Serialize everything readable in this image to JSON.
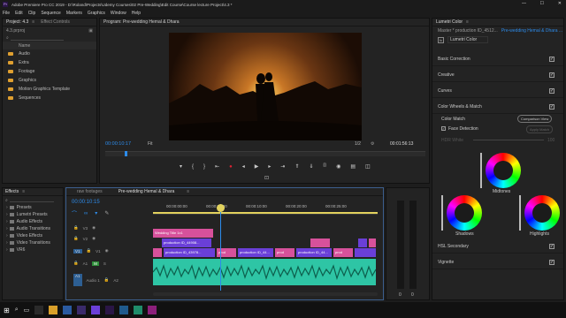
{
  "window": {
    "title": "Adobe Premiere Pro CC 2019 - D:\\Roland\\Projects\\Udemy Courses\\02 Pre-Wedding\\Edit Course\\Course lecture Project\\4.3 *",
    "minimize": "—",
    "maximize": "☐",
    "close": "✕"
  },
  "menu": [
    "File",
    "Edit",
    "Clip",
    "Sequence",
    "Markers",
    "Graphics",
    "Window",
    "Help"
  ],
  "project": {
    "tabs": [
      "Project: 4.3",
      "Effect Controls"
    ],
    "file": "4.3.prproj",
    "name_header": "Name",
    "items": [
      "Audio",
      "Extra",
      "Footage",
      "Graphics",
      "Motion Graphics Template",
      "Sequences"
    ]
  },
  "program": {
    "title": "Program: Pre-wedding Hemal & Dhara",
    "timecode": "00:00:10:17",
    "fit": "Fit",
    "resolution": "1/2",
    "duration": "00:01:56:13"
  },
  "effects": {
    "tab": "Effects",
    "items": [
      "Presets",
      "Lumetri Presets",
      "Audio Effects",
      "Audio Transitions",
      "Video Effects",
      "Video Transitions",
      "VR6"
    ]
  },
  "timeline": {
    "tabs": [
      "raw footages",
      "Pre-wedding Hemal & Dhara"
    ],
    "timecode": "00:00:10:15",
    "ruler": [
      "00:00:00:00",
      "00:00:05:00",
      "00:00:10:00",
      "00:00:20:00",
      "00:00:25:00"
    ],
    "tracks": [
      "V3",
      "V2",
      "V1",
      "A1",
      "A2"
    ],
    "clips": {
      "title": "Wedding Title 1x1",
      "c1": "production ID_44908...",
      "c2": "production ID_43978...",
      "p1": "prod",
      "p2": "production ID_44...",
      "p3": "prod",
      "p4": "production ID_44...",
      "p5": "prod"
    },
    "audio_label": "Audio 1",
    "meter_low": "0",
    "meter_high": "0"
  },
  "lumetri": {
    "title": "Lumetri Color",
    "master": "Master * production ID_4512...",
    "sequence": "Pre-wedding Hemal & Dhara ...",
    "fx": "Lumetri Color",
    "sections": [
      "Basic Correction",
      "Creative",
      "Curves",
      "Color Wheels & Match",
      "HSL Secondary",
      "Vignette"
    ],
    "color_match": "Color Match",
    "comparison_view": "Comparison View",
    "face_detection": "Face Detection",
    "apply_match": "Apply Match",
    "hdr_white": "HDR White",
    "hdr_value": "100",
    "wheels": [
      "Midtones",
      "Shadows",
      "Highlights"
    ]
  },
  "colors": {
    "accent": "#2d8ceb",
    "playhead": "#e2d25d",
    "pink": "#d7519b",
    "violet": "#6a3fd8",
    "audio": "#2ec5a5"
  }
}
